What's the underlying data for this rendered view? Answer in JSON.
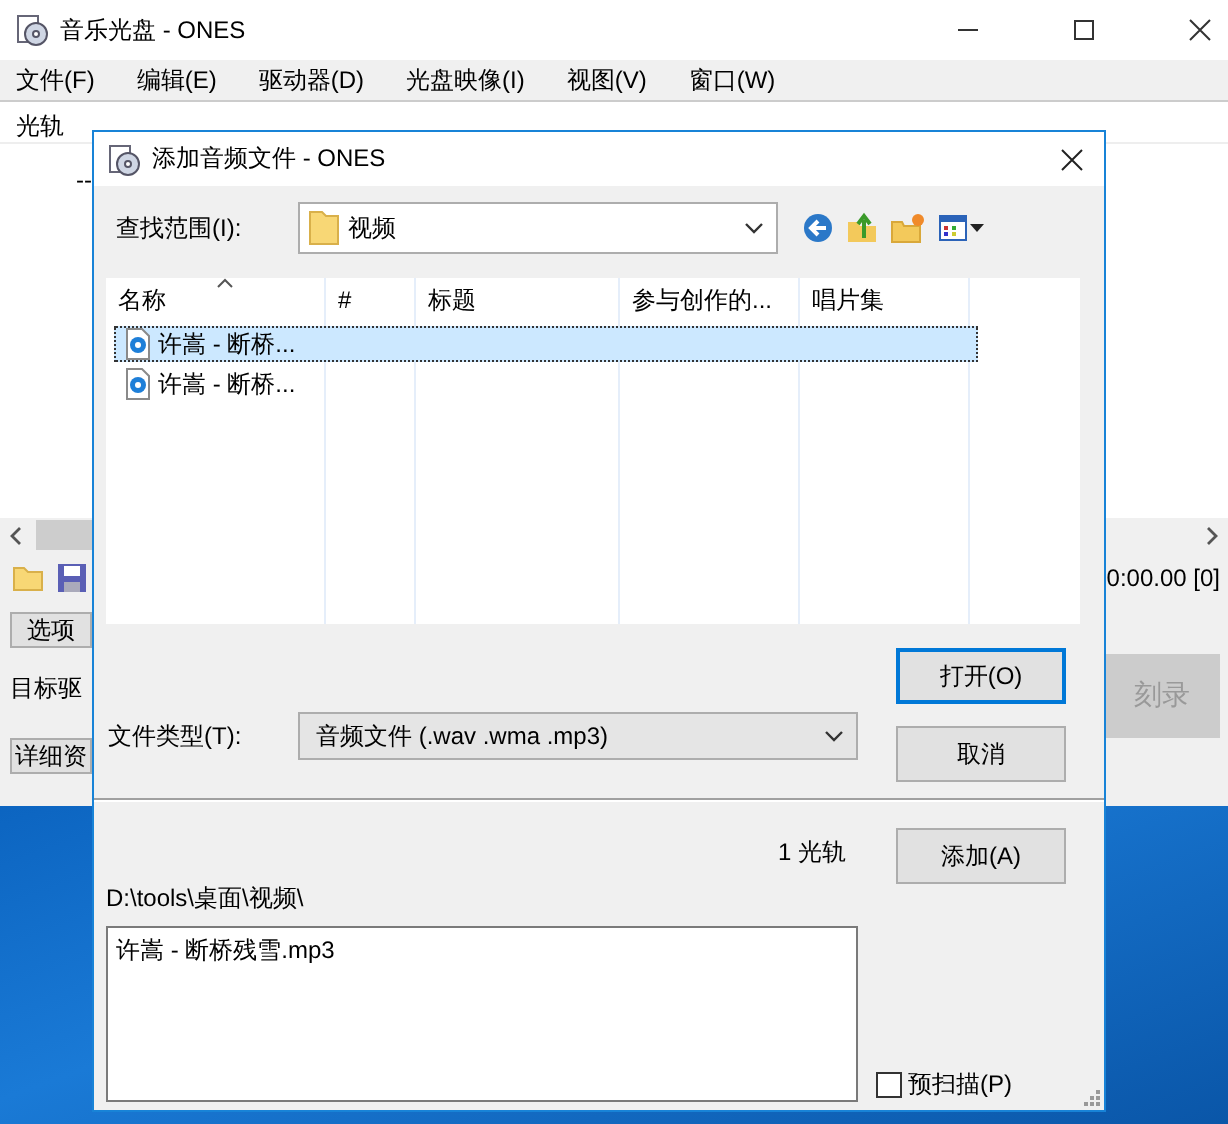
{
  "main_window": {
    "title": "音乐光盘 - ONES",
    "menu": [
      {
        "label": "文件(F)"
      },
      {
        "label": "编辑(E)"
      },
      {
        "label": "驱动器(D)"
      },
      {
        "label": "光盘映像(I)"
      },
      {
        "label": "视图(V)"
      },
      {
        "label": "窗口(W)"
      }
    ],
    "columns": [
      "光轨"
    ],
    "track_row": "--",
    "time": "0:00.00 [0]",
    "options_button": "选项",
    "target_label": "目标驱",
    "burn_button": {
      "label": "刻录",
      "disabled": true
    },
    "details_button": "详细资"
  },
  "dialog": {
    "title": "添加音频文件 - ONES",
    "look_in": {
      "label": "查找范围(I):",
      "value": "视频"
    },
    "columns": [
      {
        "label": "名称",
        "sorted": true
      },
      {
        "label": "#",
        "sorted": false
      },
      {
        "label": "标题",
        "sorted": false
      },
      {
        "label": "参与创作的...",
        "sorted": false
      },
      {
        "label": "唱片集",
        "sorted": false
      }
    ],
    "files": [
      {
        "name": "许嵩 - 断桥...",
        "selected": true
      },
      {
        "name": "许嵩 - 断桥...",
        "selected": false
      }
    ],
    "file_type": {
      "label": "文件类型(T):",
      "value": "音频文件 (.wav .wma .mp3)"
    },
    "open_button": "打开(O)",
    "cancel_button": "取消",
    "track_count": "1 光轨",
    "add_button": "添加(A)",
    "path": "D:\\tools\\桌面\\视频\\",
    "selection": "许嵩 - 断桥残雪.mp3",
    "prescan": {
      "label": "预扫描(P)",
      "checked": false
    }
  }
}
